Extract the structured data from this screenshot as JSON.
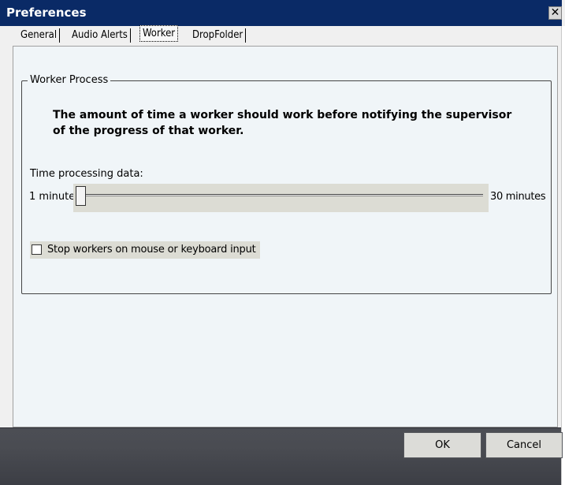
{
  "window": {
    "title": "Preferences",
    "close_label": "✕"
  },
  "tabs": [
    {
      "label": "General",
      "active": false
    },
    {
      "label": "Audio Alerts",
      "active": false
    },
    {
      "label": "Worker",
      "active": true
    },
    {
      "label": "DropFolder",
      "active": false
    }
  ],
  "worker": {
    "group_title": "Worker Process",
    "description": "The amount of time a worker should work before notifying the supervisor of the progress of that worker.",
    "slider": {
      "label": "Time processing data:",
      "min_label": "1 minute",
      "max_label": "30 minutes",
      "min": 1,
      "max": 30,
      "value": 1
    },
    "checkbox": {
      "label": "Stop workers on mouse or keyboard input",
      "checked": false
    }
  },
  "buttons": {
    "ok_label": "OK",
    "cancel_label": "Cancel"
  },
  "colors": {
    "titlebar": "#0a2a66",
    "footer": "#4a4c52"
  }
}
